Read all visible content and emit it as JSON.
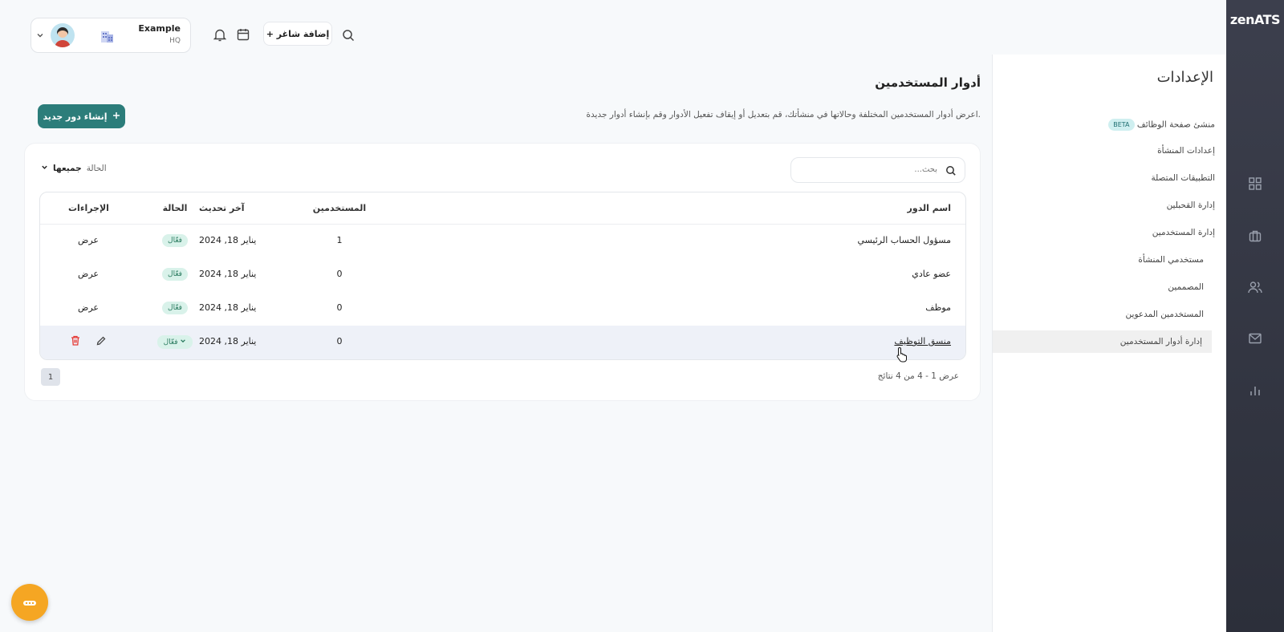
{
  "brand": "zenATS",
  "org": {
    "name": "Example",
    "sub": "HQ"
  },
  "topbar": {
    "add_job": "+ إضافة شاغر"
  },
  "settings": {
    "title": "الإعدادات",
    "beta": "BETA",
    "items": [
      {
        "label": "منشئ صفحة الوظائف"
      },
      {
        "label": "إعدادات المنشأة"
      },
      {
        "label": "التطبيقات المتصلة"
      },
      {
        "label": "إدارة القحبلين"
      },
      {
        "label": "إدارة المستخدمين"
      },
      {
        "label": "مستخدمي المنشأة"
      },
      {
        "label": "المصممين"
      },
      {
        "label": "المستخدمين المدعوين"
      },
      {
        "label": "إدارة أدوار المستخدمين"
      }
    ]
  },
  "page": {
    "title": "أدوار المستخدمين",
    "description": "اعرض أدوار المستخدمين المختلفة وحالاتها في منشأتك، قم بتعديل أو إيقاف تفعيل الأدوار وقم بإنشاء أدوار جديدة.",
    "create_button": "إنشاء دور جديد"
  },
  "search": {
    "placeholder": "بحث..."
  },
  "filter": {
    "label": "الحالة",
    "value": "جميعها"
  },
  "table": {
    "headers": {
      "role": "اسم الدور",
      "users": "المستخدمين",
      "updated": "آخر تحديث",
      "status": "الحالة",
      "actions": "الإجراءات"
    },
    "rows": [
      {
        "role": "مسؤول الحساب الرئيسي",
        "users": "1",
        "updated": "يناير 18, 2024",
        "status": "فعّال",
        "action": "عرض"
      },
      {
        "role": "عضو عادي",
        "users": "0",
        "updated": "يناير 18, 2024",
        "status": "فعّال",
        "action": "عرض"
      },
      {
        "role": "موظف",
        "users": "0",
        "updated": "يناير 18, 2024",
        "status": "فعّال",
        "action": "عرض"
      },
      {
        "role": "منسق التوظيف",
        "users": "0",
        "updated": "يناير 18, 2024",
        "status": "فعّال",
        "action": ""
      }
    ]
  },
  "pagination": {
    "page": "1",
    "results": "عرض 1 - 4 من 4 نتائج"
  },
  "colors": {
    "primary": "#2c7d7a",
    "fab": "#f5a623",
    "delete": "#e53935"
  }
}
